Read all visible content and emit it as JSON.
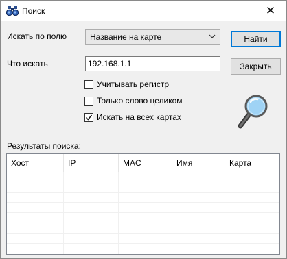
{
  "window": {
    "title": "Поиск",
    "close_glyph": "✕"
  },
  "form": {
    "field_label": "Искать по полю",
    "field_value": "Название на карте",
    "query_label": "Что искать",
    "query_value": "192.168.1.1",
    "options": [
      {
        "label": "Учитывать регистр",
        "checked": false
      },
      {
        "label": "Только слово целиком",
        "checked": false
      },
      {
        "label": "Искать на всех картах",
        "checked": true
      }
    ]
  },
  "buttons": {
    "find": "Найти",
    "close": "Закрыть"
  },
  "results": {
    "label": "Результаты поиска:",
    "columns": [
      "Хост",
      "IP",
      "MAC",
      "Имя",
      "Карта"
    ],
    "rows": []
  },
  "icons": {
    "title": "binoculars-icon",
    "dropdown": "chevron-down-icon",
    "search": "magnifier-icon",
    "close": "close-icon"
  },
  "colors": {
    "accent": "#0078d7",
    "lens": "#9fd3f5"
  }
}
